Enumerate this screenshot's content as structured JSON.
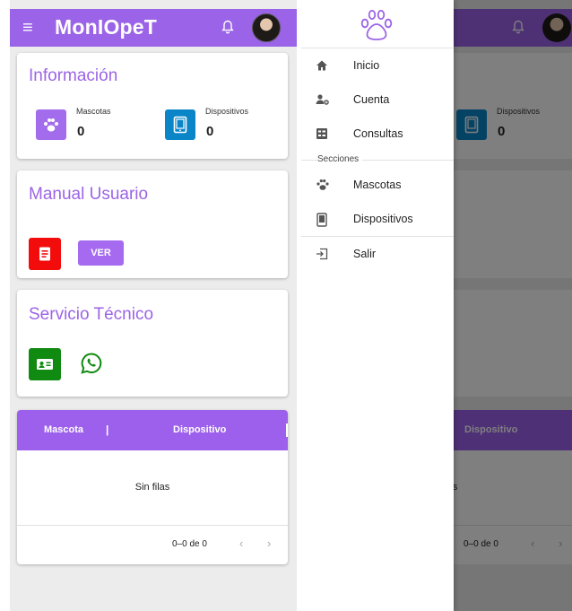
{
  "colors": {
    "primary": "#9a63e8",
    "accent": "#a56af0",
    "red": "#f20c0c",
    "green": "#108a10",
    "blue": "#0a86c8"
  },
  "app": {
    "title": "MonIOpeT",
    "menu_icon": "hamburger-icon",
    "bell_icon": "bell-icon"
  },
  "info_card": {
    "title": "Información",
    "pets_label": "Mascotas",
    "pets_value": "0",
    "devices_label": "Dispositivos",
    "devices_value": "0"
  },
  "manual_card": {
    "title": "Manual Usuario",
    "button": "VER"
  },
  "service_card": {
    "title": "Servicio Técnico"
  },
  "table": {
    "col1": "Mascota",
    "separator": "|",
    "col2": "Dispositivo",
    "empty": "Sin filas",
    "pagination": "0–0 de 0",
    "prev": "‹",
    "next": "›"
  },
  "drawer": {
    "items": [
      {
        "label": "Inicio",
        "icon": "home-icon"
      },
      {
        "label": "Cuenta",
        "icon": "account-settings-icon"
      },
      {
        "label": "Consultas",
        "icon": "form-icon"
      }
    ],
    "section": "Secciones",
    "section_items": [
      {
        "label": "Mascotas",
        "icon": "paw-icon"
      },
      {
        "label": "Dispositivos",
        "icon": "tablet-icon"
      }
    ],
    "logout": {
      "label": "Salir",
      "icon": "logout-icon"
    }
  }
}
